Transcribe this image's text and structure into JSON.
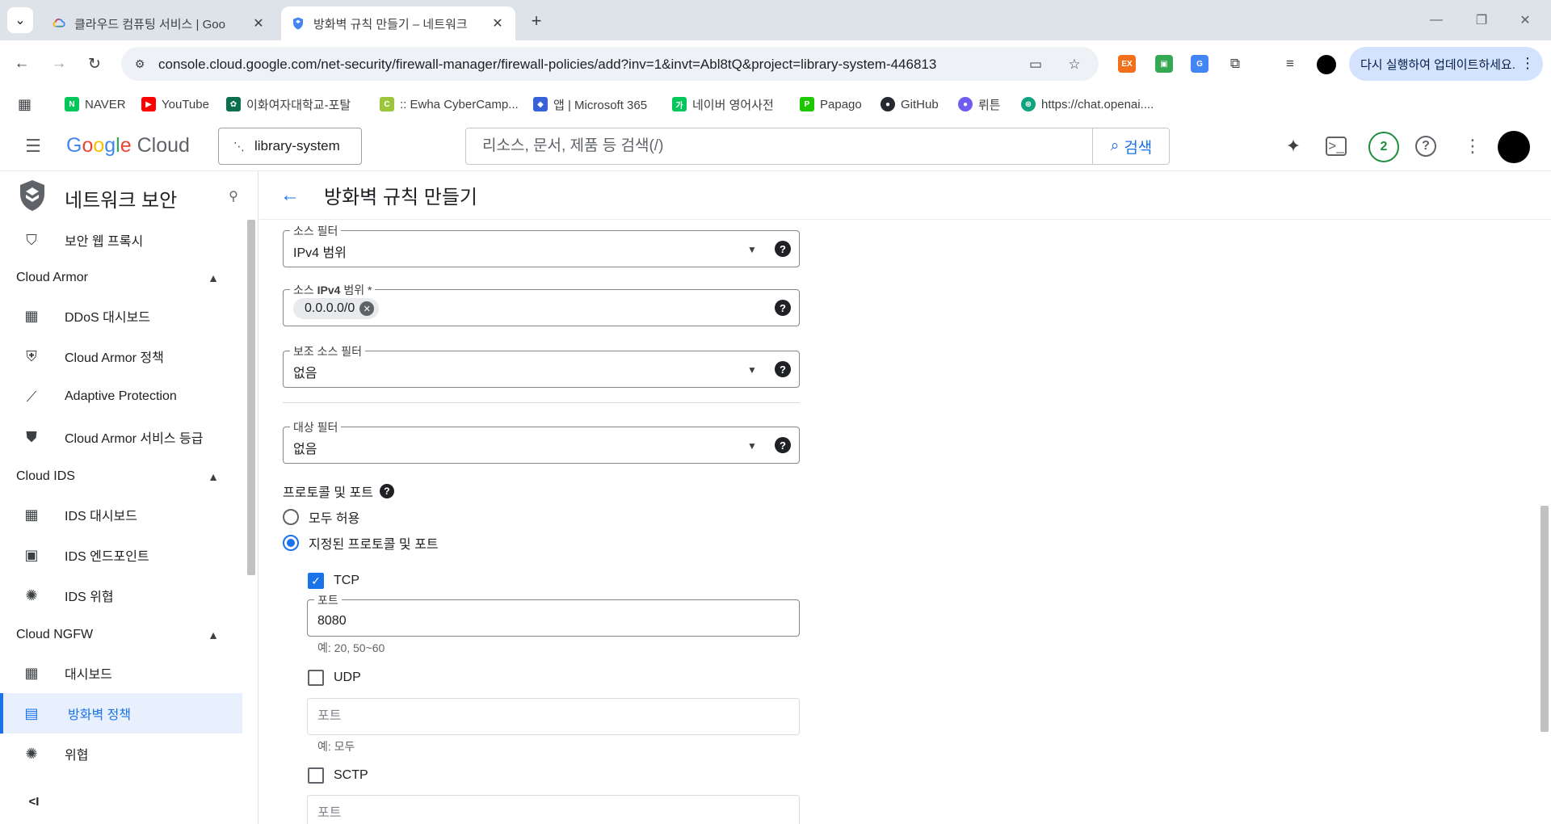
{
  "browser": {
    "tabs": [
      {
        "title": "클라우드 컴퓨팅 서비스 | Goo"
      },
      {
        "title": "방화벽 규칙 만들기 – 네트워크"
      }
    ],
    "url": "console.cloud.google.com/net-security/firewall-manager/firewall-policies/add?inv=1&invt=Abl8tQ&project=library-system-446813",
    "update_label": "다시 실행하여 업데이트하세요.",
    "extensions": [
      {
        "label": "EX",
        "color": "#f46f1b"
      },
      {
        "label": "▣",
        "color": "#34a853"
      },
      {
        "label": "G",
        "color": "#4285f4"
      }
    ],
    "bookmarks": [
      {
        "label": "NAVER",
        "icon": "N",
        "color": "#03c75a"
      },
      {
        "label": "YouTube",
        "icon": "▶",
        "color": "#ff0000"
      },
      {
        "label": "이화여자대학교-포탈",
        "icon": "✿",
        "color": "#0b6e4f"
      },
      {
        "label": ":: Ewha CyberCamp...",
        "icon": "C",
        "color": "#9bc53d"
      },
      {
        "label": "앱 | Microsoft 365",
        "icon": "◆",
        "color": "#3a62d8"
      },
      {
        "label": "네이버 영어사전",
        "icon": "가",
        "color": "#03c75a"
      },
      {
        "label": "Papago",
        "icon": "P",
        "color": "#1ec800"
      },
      {
        "label": "GitHub",
        "icon": "●",
        "color": "#24292f"
      },
      {
        "label": "뤼튼",
        "icon": "●",
        "color": "#6f5cf1"
      },
      {
        "label": "https://chat.openai....",
        "icon": "⊛",
        "color": "#10a37f"
      }
    ]
  },
  "header": {
    "logo_google": "Google",
    "logo_cloud": "Cloud",
    "logo_colors": [
      "#4285f4",
      "#ea4335",
      "#fbbc04",
      "#4285f4",
      "#34a853",
      "#ea4335"
    ],
    "project": "library-system",
    "search_placeholder": "리소스, 문서, 제품 등 검색(/)",
    "search_button": "검색",
    "notification_count": "2"
  },
  "sidebar": {
    "title": "네트워크 보안",
    "items": [
      {
        "type": "item",
        "label": "보안 웹 프록시",
        "icon": "proxy-icon"
      },
      {
        "type": "section",
        "label": "Cloud Armor"
      },
      {
        "type": "item",
        "label": "DDoS 대시보드",
        "icon": "dashboard-icon"
      },
      {
        "type": "item",
        "label": "Cloud Armor 정책",
        "icon": "shield-policy-icon"
      },
      {
        "type": "item",
        "label": "Adaptive Protection",
        "icon": "chart-icon"
      },
      {
        "type": "item",
        "label": "Cloud Armor 서비스 등급",
        "icon": "shield-tier-icon"
      },
      {
        "type": "section",
        "label": "Cloud IDS"
      },
      {
        "type": "item",
        "label": "IDS 대시보드",
        "icon": "dashboard-icon"
      },
      {
        "type": "item",
        "label": "IDS 엔드포인트",
        "icon": "endpoint-icon"
      },
      {
        "type": "item",
        "label": "IDS 위협",
        "icon": "threat-icon"
      },
      {
        "type": "section",
        "label": "Cloud NGFW"
      },
      {
        "type": "item",
        "label": "대시보드",
        "icon": "dashboard-icon"
      },
      {
        "type": "item",
        "label": "방화벽 정책",
        "icon": "firewall-icon",
        "active": true
      },
      {
        "type": "item",
        "label": "위협",
        "icon": "threat-icon"
      }
    ]
  },
  "page": {
    "title": "방화벽 규칙 만들기",
    "source_filter": {
      "label": "소스 필터",
      "value": "IPv4 범위"
    },
    "source_ipv4": {
      "label_prefix": "소스 ",
      "label_bold": "IPv4",
      "label_suffix": " 범위 *",
      "chip": "0.0.0.0/0"
    },
    "secondary_source_filter": {
      "label": "보조 소스 필터",
      "value": "없음"
    },
    "target_filter": {
      "label": "대상 필터",
      "value": "없음"
    },
    "protocols": {
      "label": "프로토콜 및 포트",
      "allow_all": "모두 허용",
      "specified": "지정된 프로토콜 및 포트",
      "tcp": {
        "label": "TCP",
        "checked": true,
        "port_label": "포트",
        "port_value": "8080",
        "hint": "예: 20, 50~60"
      },
      "udp": {
        "label": "UDP",
        "checked": false,
        "placeholder": "포트",
        "hint": "예: 모두"
      },
      "sctp": {
        "label": "SCTP",
        "checked": false,
        "placeholder": "포트"
      }
    }
  }
}
